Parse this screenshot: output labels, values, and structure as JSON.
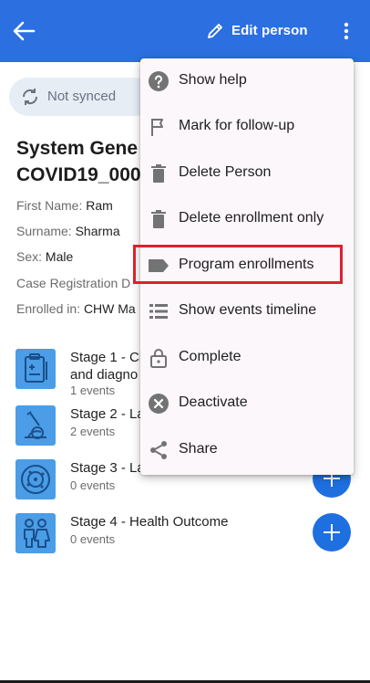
{
  "appbar": {
    "edit_label": "Edit person",
    "icons": {
      "back": "arrow-left-icon",
      "edit": "pencil-icon",
      "more": "more-vertical-icon"
    },
    "color": "#2C6FE0"
  },
  "sync": {
    "label": "Not synced",
    "icon": "sync-icon"
  },
  "profile": {
    "title_line1": "System Gene",
    "title_line2": "COVID19_000",
    "attributes": [
      {
        "label": "First Name: ",
        "value": "Ram"
      },
      {
        "label": "Surname: ",
        "value": "Sharma"
      },
      {
        "label": "Sex: ",
        "value": "Male"
      },
      {
        "label": "Case Registration D",
        "value": ""
      },
      {
        "label": "Enrolled in: ",
        "value": "CHW Ma"
      }
    ]
  },
  "stages": [
    {
      "name_line1": "Stage 1 - Cl",
      "name_line2": "and diagno",
      "events": "1 events",
      "icon": "clipboard-icon"
    },
    {
      "name_line1": "Stage 2 - La",
      "events": "2 events",
      "icon": "microscope-icon"
    },
    {
      "name_line1": "Stage 3 - La",
      "events": "0 events",
      "icon": "virus-icon"
    },
    {
      "name_line1": "Stage 4 - Health Outcome",
      "events": "0 events",
      "icon": "people-icon"
    }
  ],
  "menu": {
    "items": [
      {
        "label": "Show help",
        "icon": "help-circle-icon"
      },
      {
        "label": "Mark for follow-up",
        "icon": "flag-icon"
      },
      {
        "label": "Delete Person",
        "icon": "trash-icon"
      },
      {
        "label": "Delete enrollment only",
        "icon": "trash-icon"
      },
      {
        "label": "Program enrollments",
        "icon": "label-tag-icon",
        "highlighted": true
      },
      {
        "label": "Show events timeline",
        "icon": "list-icon"
      },
      {
        "label": "Complete",
        "icon": "lock-icon"
      },
      {
        "label": "Deactivate",
        "icon": "close-circle-icon"
      },
      {
        "label": "Share",
        "icon": "share-icon"
      }
    ]
  },
  "colors": {
    "accent": "#1E6FE0",
    "highlight": "#E0202E",
    "stage_icon_bg": "#4A9DE6"
  }
}
